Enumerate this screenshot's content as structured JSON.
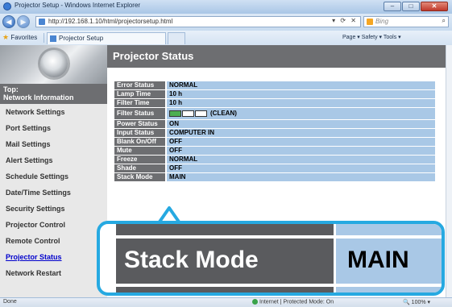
{
  "window": {
    "title": "Projector Setup - Windows Internet Explorer",
    "controls": [
      "–",
      "□",
      "✕"
    ]
  },
  "addressbar": {
    "url": "http://192.168.1.10/html/projectorsetup.html",
    "search_placeholder": "Bing"
  },
  "favorites": {
    "favorites_label": "Favorites",
    "tab_title": "Projector Setup",
    "tools": "Page ▾  Safety ▾  Tools ▾"
  },
  "sidebar": {
    "top_line1": "Top:",
    "top_line2": "Network Information",
    "items": [
      {
        "label": "Network Settings"
      },
      {
        "label": "Port Settings"
      },
      {
        "label": "Mail Settings"
      },
      {
        "label": "Alert Settings"
      },
      {
        "label": "Schedule Settings"
      },
      {
        "label": "Date/Time Settings"
      },
      {
        "label": "Security Settings"
      },
      {
        "label": "Projector Control"
      },
      {
        "label": "Remote Control"
      },
      {
        "label": "Projector Status",
        "active": true
      },
      {
        "label": "Network Restart"
      }
    ]
  },
  "main": {
    "title": "Projector Status",
    "rows": [
      {
        "label": "Error Status",
        "value": "NORMAL"
      },
      {
        "label": "Lamp Time",
        "value": "10 h"
      },
      {
        "label": "Filter Time",
        "value": "10 h"
      },
      {
        "label": "Filter Status",
        "value": "(CLEAN)",
        "boxes": [
          "on",
          "off",
          "off"
        ]
      },
      {
        "label": "Power Status",
        "value": "ON"
      },
      {
        "label": "Input Status",
        "value": "COMPUTER IN"
      },
      {
        "label": "Blank On/Off",
        "value": "OFF"
      },
      {
        "label": "Mute",
        "value": "OFF"
      },
      {
        "label": "Freeze",
        "value": "NORMAL"
      },
      {
        "label": "Shade",
        "value": "OFF"
      },
      {
        "label": "Stack Mode",
        "value": "MAIN"
      }
    ]
  },
  "callout": {
    "label": "Stack Mode",
    "value": "MAIN"
  },
  "statusbar": {
    "left": "Done",
    "zone": "Internet | Protected Mode: On",
    "zoom": "100%"
  },
  "colors": {
    "label_bg": "#6d6e71",
    "value_bg": "#a9c8e6",
    "callout_border": "#26a9e1",
    "filter_ok": "#4caf50"
  },
  "icons": [
    "back-arrow-icon",
    "forward-arrow-icon",
    "favorites-star-icon",
    "bing-icon",
    "globe-icon",
    "lens-icon"
  ]
}
